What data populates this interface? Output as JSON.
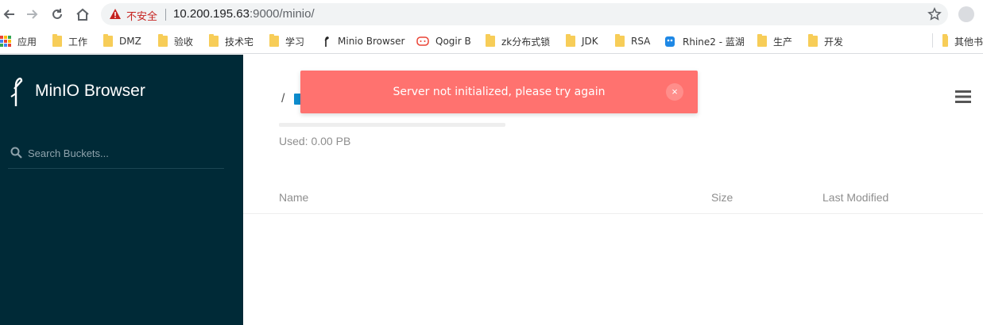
{
  "browser": {
    "security_label": "不安全",
    "url_host": "10.200.195.63",
    "url_path": ":9000/minio/",
    "bookmarks": [
      {
        "label": "应用",
        "icon": "apps-grid-icon"
      },
      {
        "label": "工作",
        "icon": "folder-icon"
      },
      {
        "label": "DMZ",
        "icon": "folder-icon"
      },
      {
        "label": "验收",
        "icon": "folder-icon"
      },
      {
        "label": "技术宅",
        "icon": "folder-icon"
      },
      {
        "label": "学习",
        "icon": "folder-icon"
      },
      {
        "label": "Minio Browser",
        "icon": "minio-logo-icon"
      },
      {
        "label": "Qogir B",
        "icon": "qogir-icon"
      },
      {
        "label": "zk分布式锁",
        "icon": "folder-icon"
      },
      {
        "label": "JDK",
        "icon": "folder-icon"
      },
      {
        "label": "RSA",
        "icon": "folder-icon"
      },
      {
        "label": "Rhine2 - 蓝湖",
        "icon": "lanhu-icon"
      },
      {
        "label": "生产",
        "icon": "folder-icon"
      },
      {
        "label": "开发",
        "icon": "folder-icon"
      },
      {
        "label": "其他书",
        "icon": "folder-icon"
      }
    ]
  },
  "sidebar": {
    "brand": "MinIO Browser",
    "search_placeholder": "Search Buckets..."
  },
  "main": {
    "breadcrumb_separator": "/",
    "usage_fraction": 0.0,
    "used_label": "Used: 0.00 PB",
    "columns": {
      "name": "Name",
      "size": "Size",
      "modified": "Last Modified"
    }
  },
  "alert": {
    "message": "Server not initialized, please try again",
    "close_symbol": "×"
  },
  "colors": {
    "sidebar_bg": "#002a37",
    "alert_bg": "#ff726f",
    "insecure_red": "#c5221f",
    "accent_blue": "#0d8ccd"
  }
}
